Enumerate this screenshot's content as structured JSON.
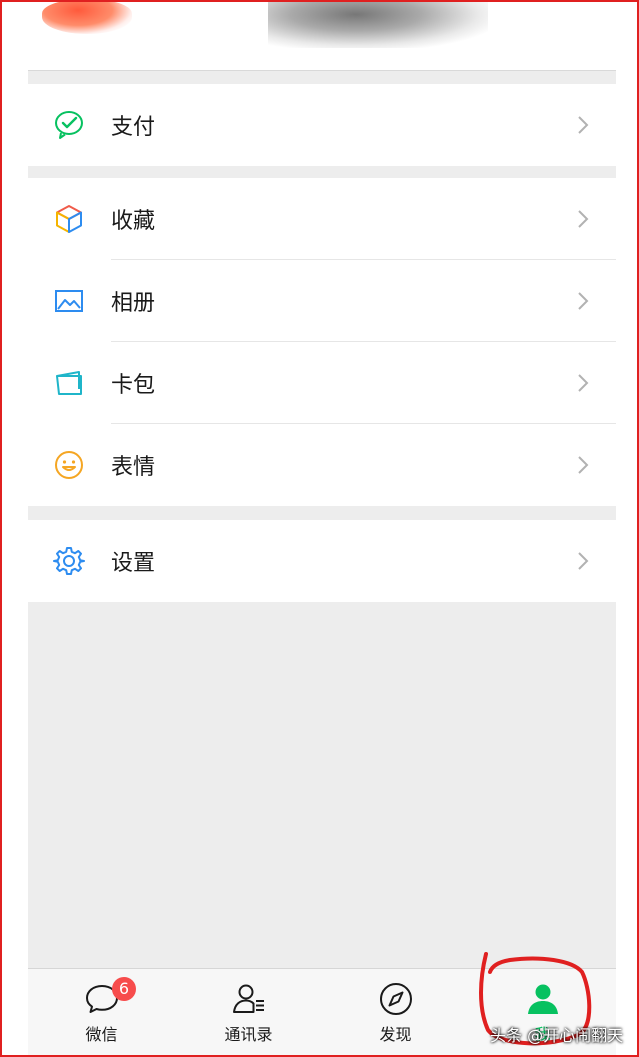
{
  "menu": {
    "pay_label": "支付",
    "favorites_label": "收藏",
    "album_label": "相册",
    "cards_label": "卡包",
    "stickers_label": "表情",
    "settings_label": "设置"
  },
  "tabbar": {
    "chats_label": "微信",
    "chats_badge": "6",
    "contacts_label": "通讯录",
    "discover_label": "发现",
    "me_label": "我"
  },
  "watermark": "头条 @开心闹翻天",
  "icons": {
    "pay": "wechat-pay-icon",
    "favorites": "cube-icon",
    "album": "picture-icon",
    "cards": "card-wallet-icon",
    "stickers": "smiley-icon",
    "settings": "gear-icon"
  },
  "colors": {
    "accent": "#07c160",
    "badge": "#f74c4c",
    "annotation": "#e02020"
  }
}
